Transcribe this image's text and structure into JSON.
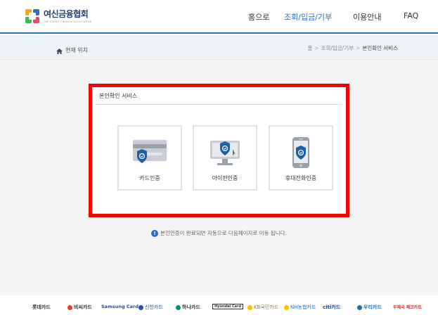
{
  "header": {
    "logo_title": "여신금융협회",
    "logo_subtitle": "THE CREDIT FINANCE ASSOCIATION",
    "nav": [
      {
        "label": "홈으로"
      },
      {
        "label": "조회/입금/기부"
      },
      {
        "label": "이용안내"
      },
      {
        "label": "FAQ"
      }
    ]
  },
  "breadcrumb": {
    "location_label": "현재 위치",
    "path": [
      "홈",
      "조회/입금/기부",
      "본인확인 서비스"
    ]
  },
  "panel": {
    "title": "본인확인 서비스",
    "cards": [
      {
        "label": "카드인증",
        "icon": "credit-card-shield-icon"
      },
      {
        "label": "아이핀인증",
        "icon": "monitor-shield-icon"
      },
      {
        "label": "휴대전화인증",
        "icon": "phone-shield-icon"
      }
    ]
  },
  "notice": {
    "icon": "!",
    "text": "본인인증이 완료되면 자동으로 다음페이지로 이동 됩니다."
  },
  "footer": {
    "partners": [
      {
        "label": "롯데카드",
        "color": "#222222"
      },
      {
        "label": "비씨카드",
        "color": "#e03a3a"
      },
      {
        "label": "Samsung Card",
        "color": "#1c4fa0"
      },
      {
        "label": "신한카드",
        "color": "#2a4fa0"
      },
      {
        "label": "하나카드",
        "color": "#0b8a7a"
      },
      {
        "label": "Hyundai Card",
        "color": "#222222"
      },
      {
        "label": "KB국민카드",
        "color": "#8a7a50"
      },
      {
        "label": "NH농협카드",
        "color": "#2a6fc4"
      },
      {
        "label": "citi카드",
        "color": "#1a3a8a"
      },
      {
        "label": "우리카드",
        "color": "#1f6fb0"
      },
      {
        "label": "우체국 체크카드",
        "color": "#d02020"
      }
    ]
  },
  "colors": {
    "accent": "#2a6fc4",
    "highlight": "#ff0000"
  }
}
